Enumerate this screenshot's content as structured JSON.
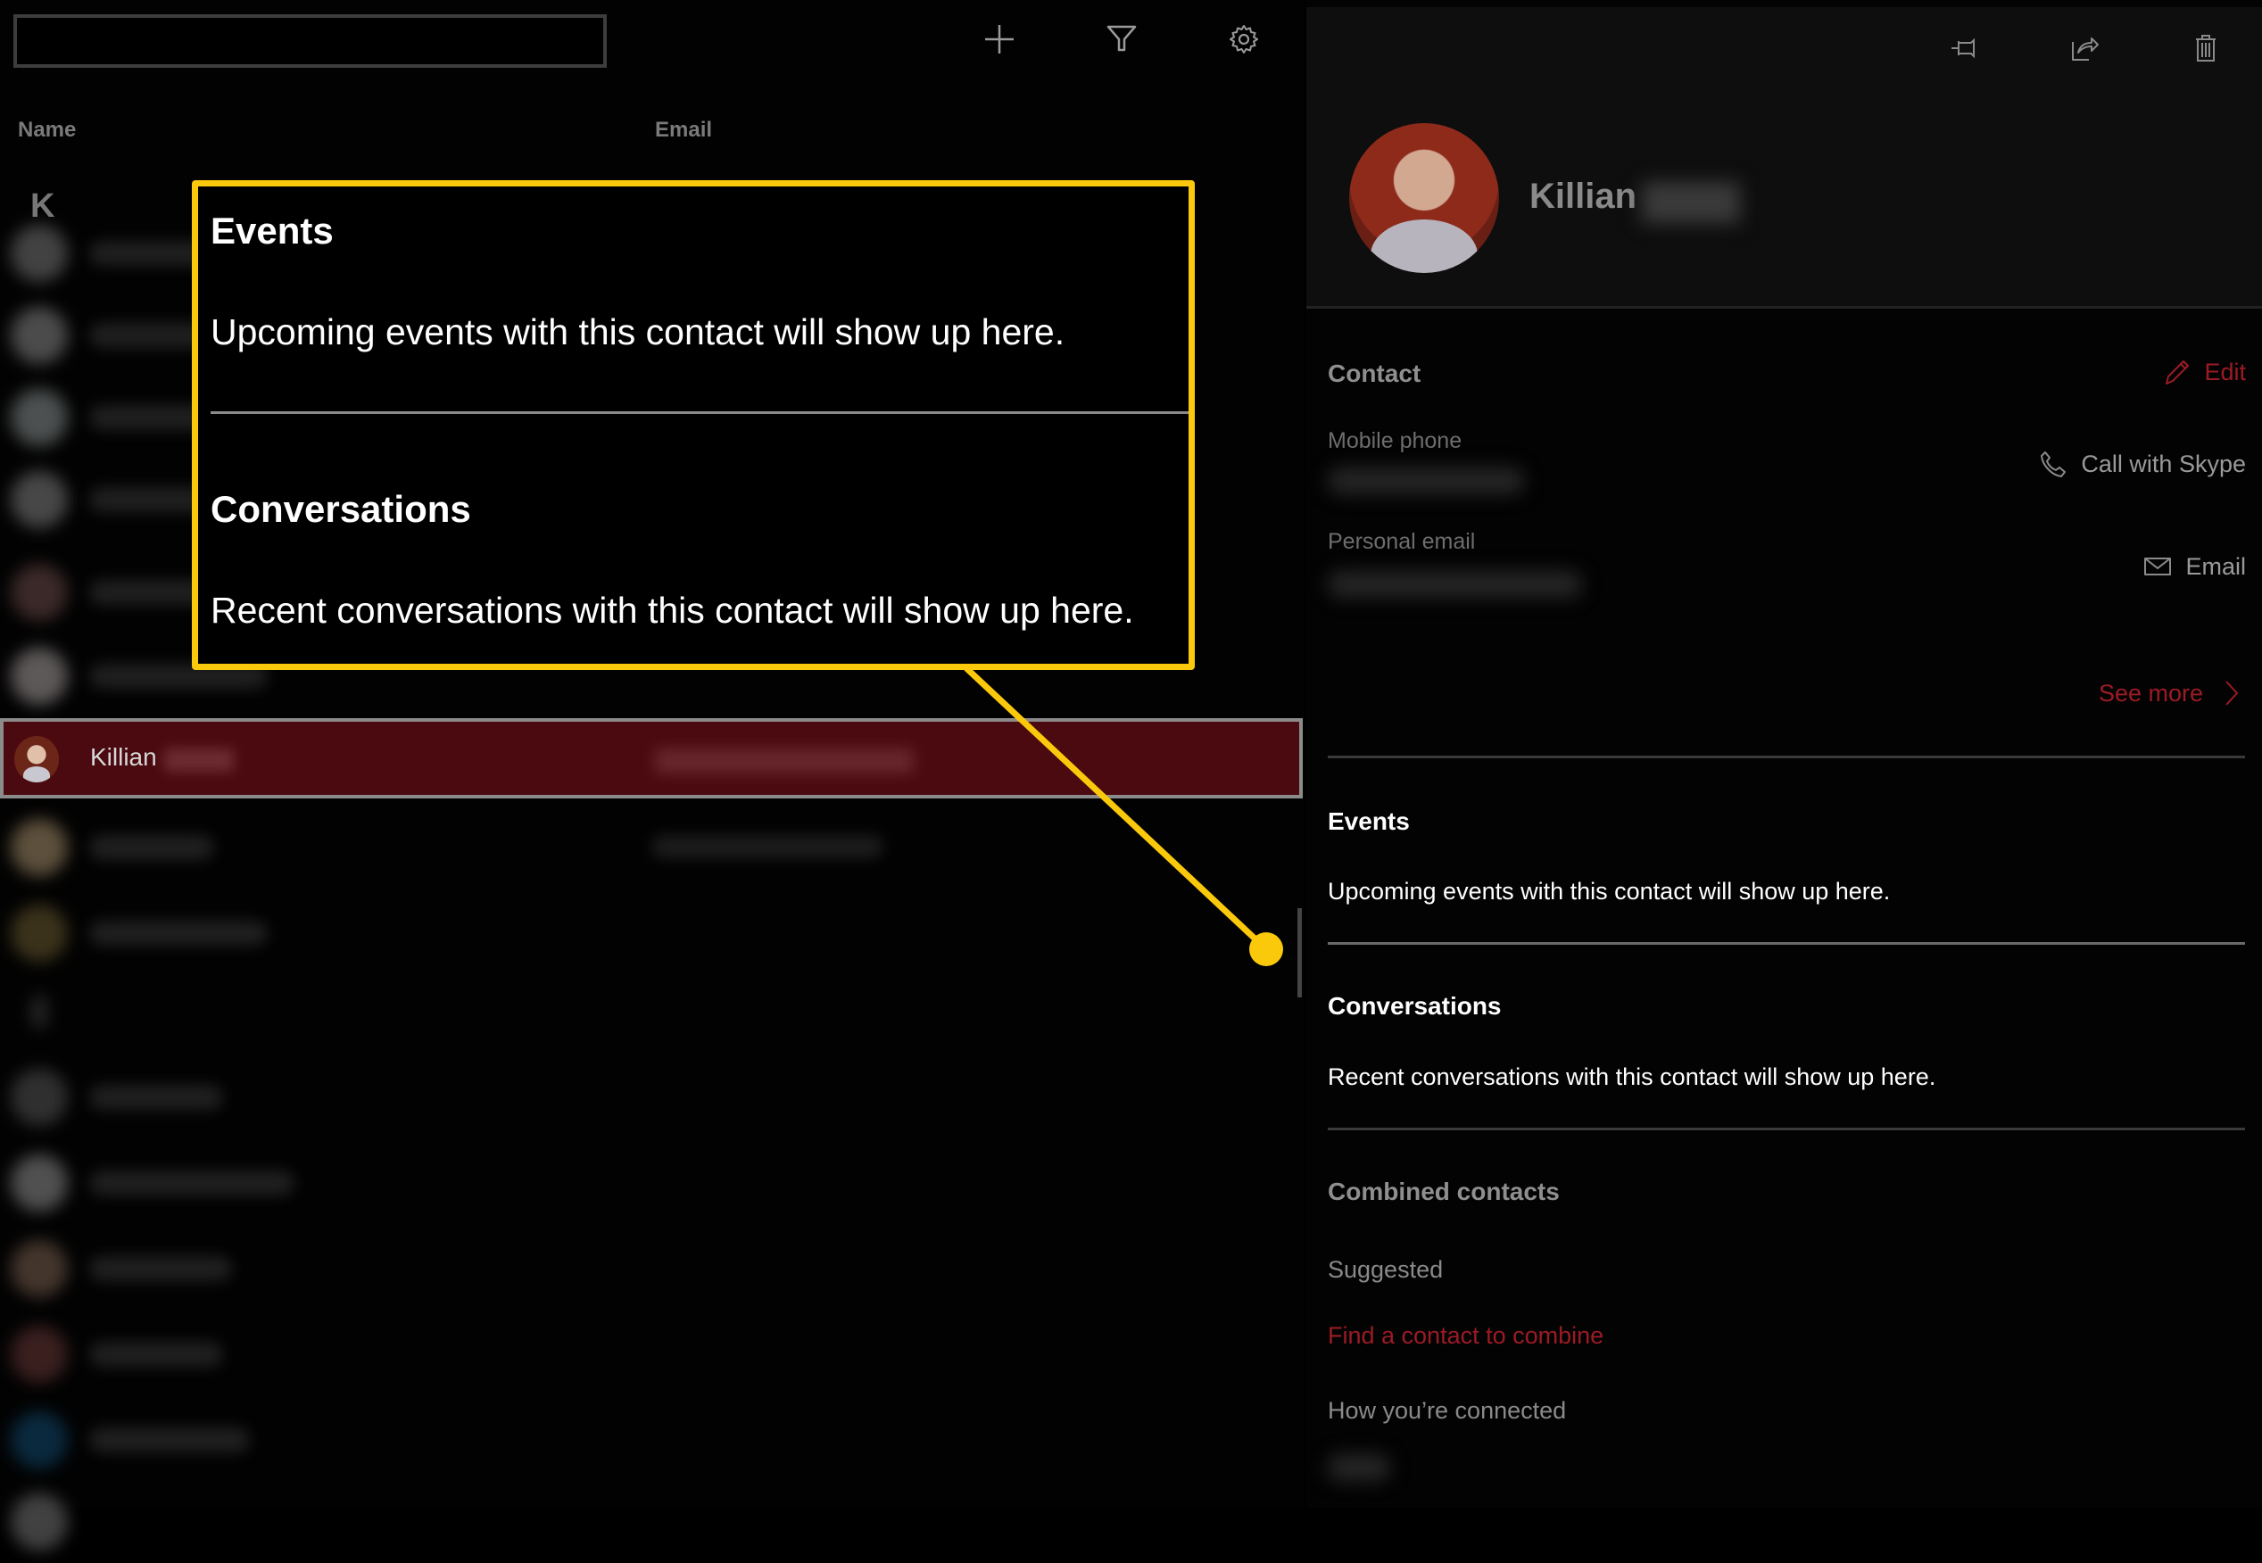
{
  "list": {
    "search_placeholder": "",
    "toolbar": {
      "add_icon": "plus-icon",
      "filter_icon": "filter-icon",
      "settings_icon": "gear-icon"
    },
    "columns": {
      "name": "Name",
      "email": "Email"
    },
    "group_letter": "K",
    "selected_contact": {
      "first_name": "Killian"
    }
  },
  "detail": {
    "toolbar": {
      "pin_icon": "pin-icon",
      "share_icon": "share-icon",
      "delete_icon": "trash-icon"
    },
    "name": "Killian",
    "contact": {
      "title": "Contact",
      "edit_label": "Edit",
      "mobile_label": "Mobile phone",
      "call_label": "Call with Skype",
      "email_label": "Personal email",
      "email_action": "Email",
      "see_more": "See more"
    },
    "events": {
      "title": "Events",
      "text": "Upcoming events with this contact will show up here."
    },
    "conversations": {
      "title": "Conversations",
      "text": "Recent conversations with this contact will show up here."
    },
    "combined": {
      "title": "Combined contacts",
      "suggested": "Suggested",
      "find_link": "Find a contact to combine",
      "connected": "How you’re connected"
    }
  },
  "callout": {
    "events_title": "Events",
    "events_text": "Upcoming events with this contact will show up here.",
    "conversations_title": "Conversations",
    "conversations_text": "Recent conversations with this contact will show up here."
  },
  "colors": {
    "accent": "#9b1b24",
    "selection": "#4a0a10",
    "callout": "#fbc90c"
  }
}
